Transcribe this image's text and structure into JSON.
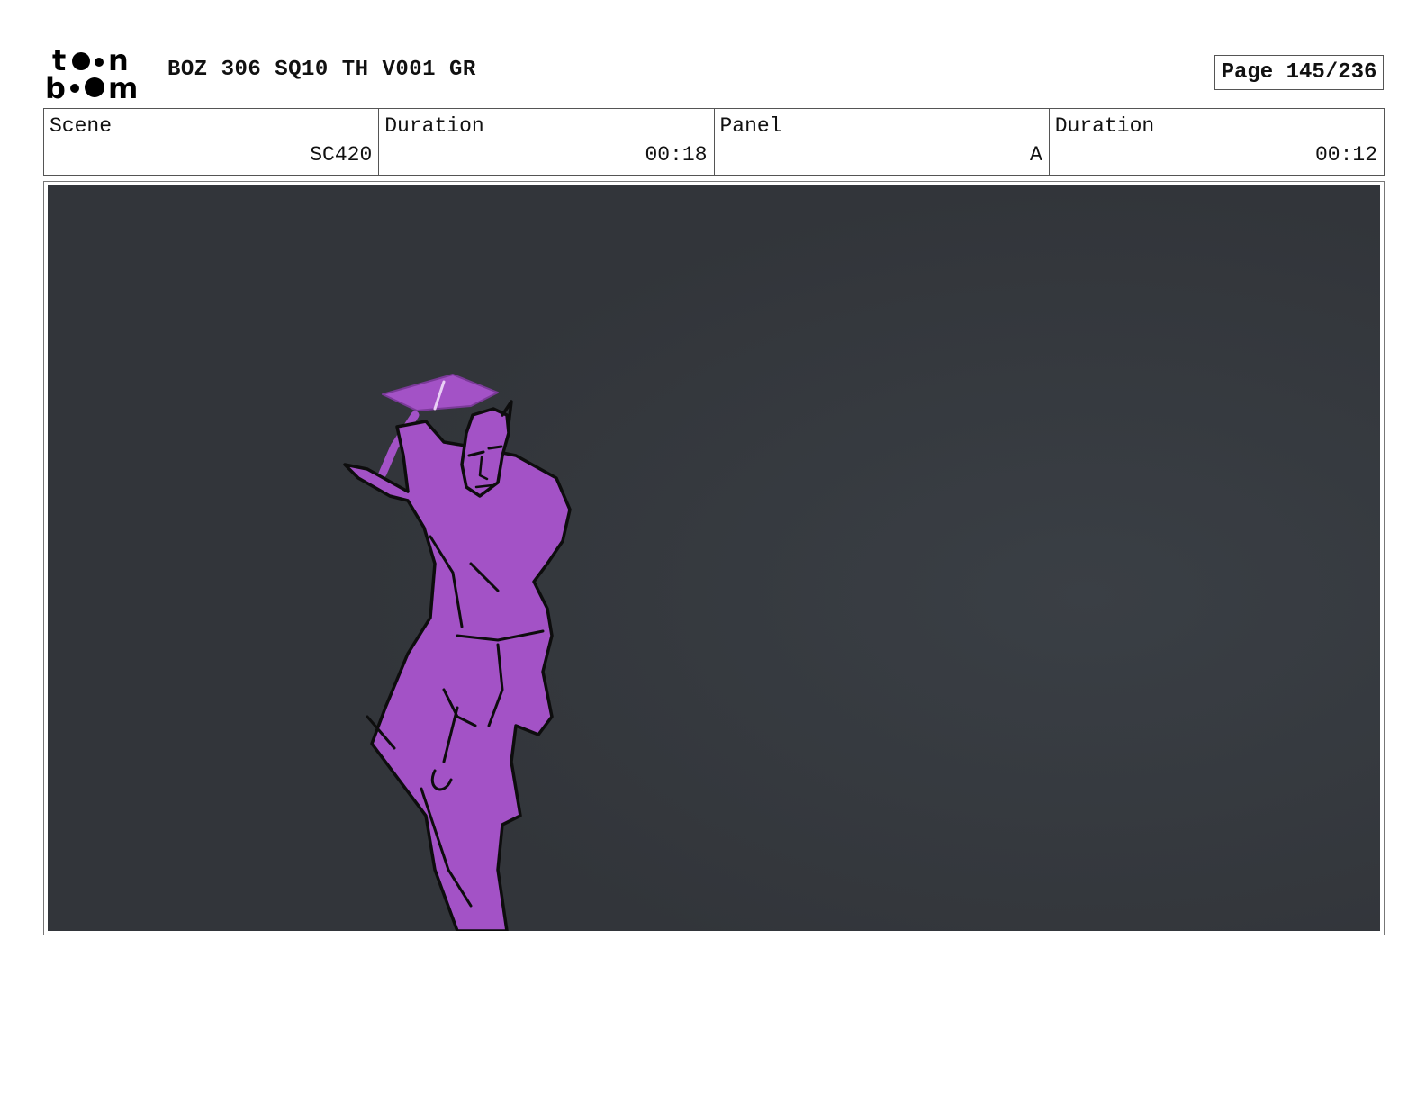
{
  "header": {
    "logo_text": "toon boom",
    "title": "BOZ 306 SQ10 TH V001 GR",
    "page": "Page 145/236"
  },
  "info": {
    "scene_label": "Scene",
    "scene_value": "SC420",
    "scene_duration_label": "Duration",
    "scene_duration_value": "00:18",
    "panel_label": "Panel",
    "panel_value": "A",
    "panel_duration_label": "Duration",
    "panel_duration_value": "00:12"
  },
  "colors": {
    "panel_background": "#33363a",
    "character_fill": "#a352c6",
    "line_art": "#0d0d0d"
  }
}
